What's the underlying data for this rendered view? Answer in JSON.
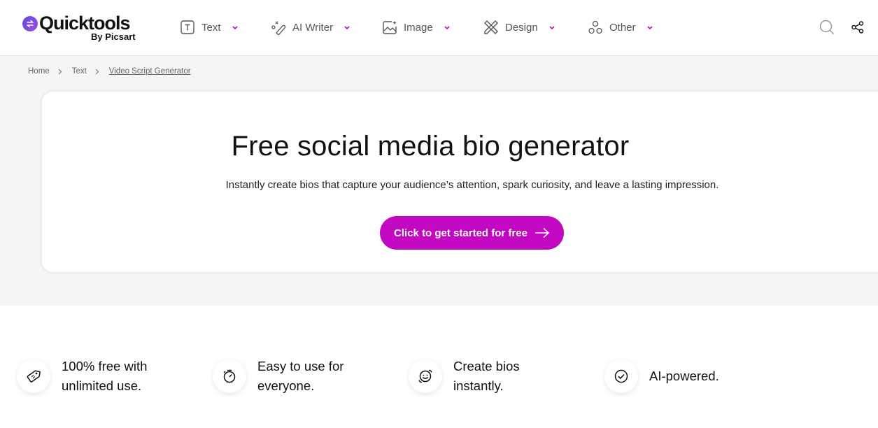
{
  "header": {
    "logo": {
      "name": "Quicktools",
      "sub": "By Picsart"
    },
    "nav": [
      {
        "label": "Text",
        "icon": "text-box-icon"
      },
      {
        "label": "AI Writer",
        "icon": "magic-wand-icon"
      },
      {
        "label": "Image",
        "icon": "image-sparkle-icon"
      },
      {
        "label": "Design",
        "icon": "pencil-ruler-icon"
      },
      {
        "label": "Other",
        "icon": "circles-icon"
      }
    ],
    "search_icon": "search-icon",
    "share_icon": "share-icon"
  },
  "breadcrumb": {
    "items": [
      "Home",
      "Text"
    ],
    "current": "Video Script Generator"
  },
  "hero": {
    "title": "Free social media bio generator",
    "subtitle": "Instantly create bios that capture your audience’s attention, spark curiosity, and leave a lasting impression.",
    "cta_label": "Click to get started for free"
  },
  "features": [
    {
      "text": "100% free with unlimited use.",
      "icon": "price-tag-icon"
    },
    {
      "text": "Easy to use for everyone.",
      "icon": "stopwatch-icon"
    },
    {
      "text": "Create bios instantly.",
      "icon": "smiley-orbit-icon"
    },
    {
      "text": "AI-powered.",
      "icon": "check-circle-icon"
    }
  ],
  "colors": {
    "accent": "#c209c1",
    "logo_gradient_start": "#5b4ee8",
    "logo_gradient_end": "#a44ad9",
    "hero_background": "#f5f5f5"
  }
}
